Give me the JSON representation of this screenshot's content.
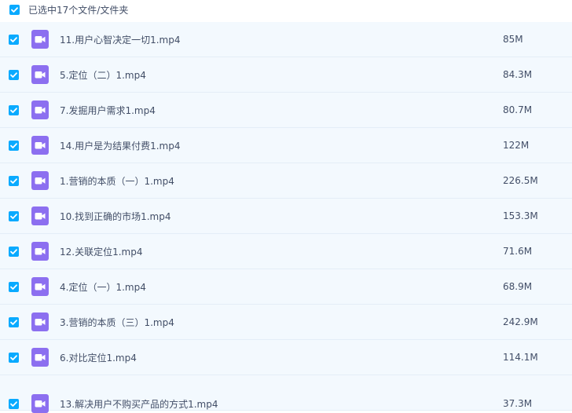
{
  "header": {
    "selection_label": "已选中17个文件/文件夹",
    "checked": true
  },
  "colors": {
    "checkbox": "#09aaff",
    "video_icon": "#8c6ff0",
    "row_background": "#f3f9fe",
    "text": "#424e67"
  },
  "files": [
    {
      "name": "11.用户心智决定一切1.mp4",
      "size": "85M",
      "icon": "video-file-icon",
      "checked": true
    },
    {
      "name": "5.定位（二）1.mp4",
      "size": "84.3M",
      "icon": "video-file-icon",
      "checked": true
    },
    {
      "name": "7.发掘用户需求1.mp4",
      "size": "80.7M",
      "icon": "video-file-icon",
      "checked": true
    },
    {
      "name": "14.用户是为结果付费1.mp4",
      "size": "122M",
      "icon": "video-file-icon",
      "checked": true
    },
    {
      "name": "1.营销的本质（一）1.mp4",
      "size": "226.5M",
      "icon": "video-file-icon",
      "checked": true
    },
    {
      "name": "10.找到正确的市场1.mp4",
      "size": "153.3M",
      "icon": "video-file-icon",
      "checked": true
    },
    {
      "name": "12.关联定位1.mp4",
      "size": "71.6M",
      "icon": "video-file-icon",
      "checked": true
    },
    {
      "name": "4.定位（一）1.mp4",
      "size": "68.9M",
      "icon": "video-file-icon",
      "checked": true
    },
    {
      "name": "3.营销的本质（三）1.mp4",
      "size": "242.9M",
      "icon": "video-file-icon",
      "checked": true
    },
    {
      "name": "6.对比定位1.mp4",
      "size": "114.1M",
      "icon": "video-file-icon",
      "checked": true
    },
    {
      "name": "13.解决用户不购买产品的方式1.mp4",
      "size": "37.3M",
      "icon": "video-file-icon",
      "checked": true
    }
  ]
}
